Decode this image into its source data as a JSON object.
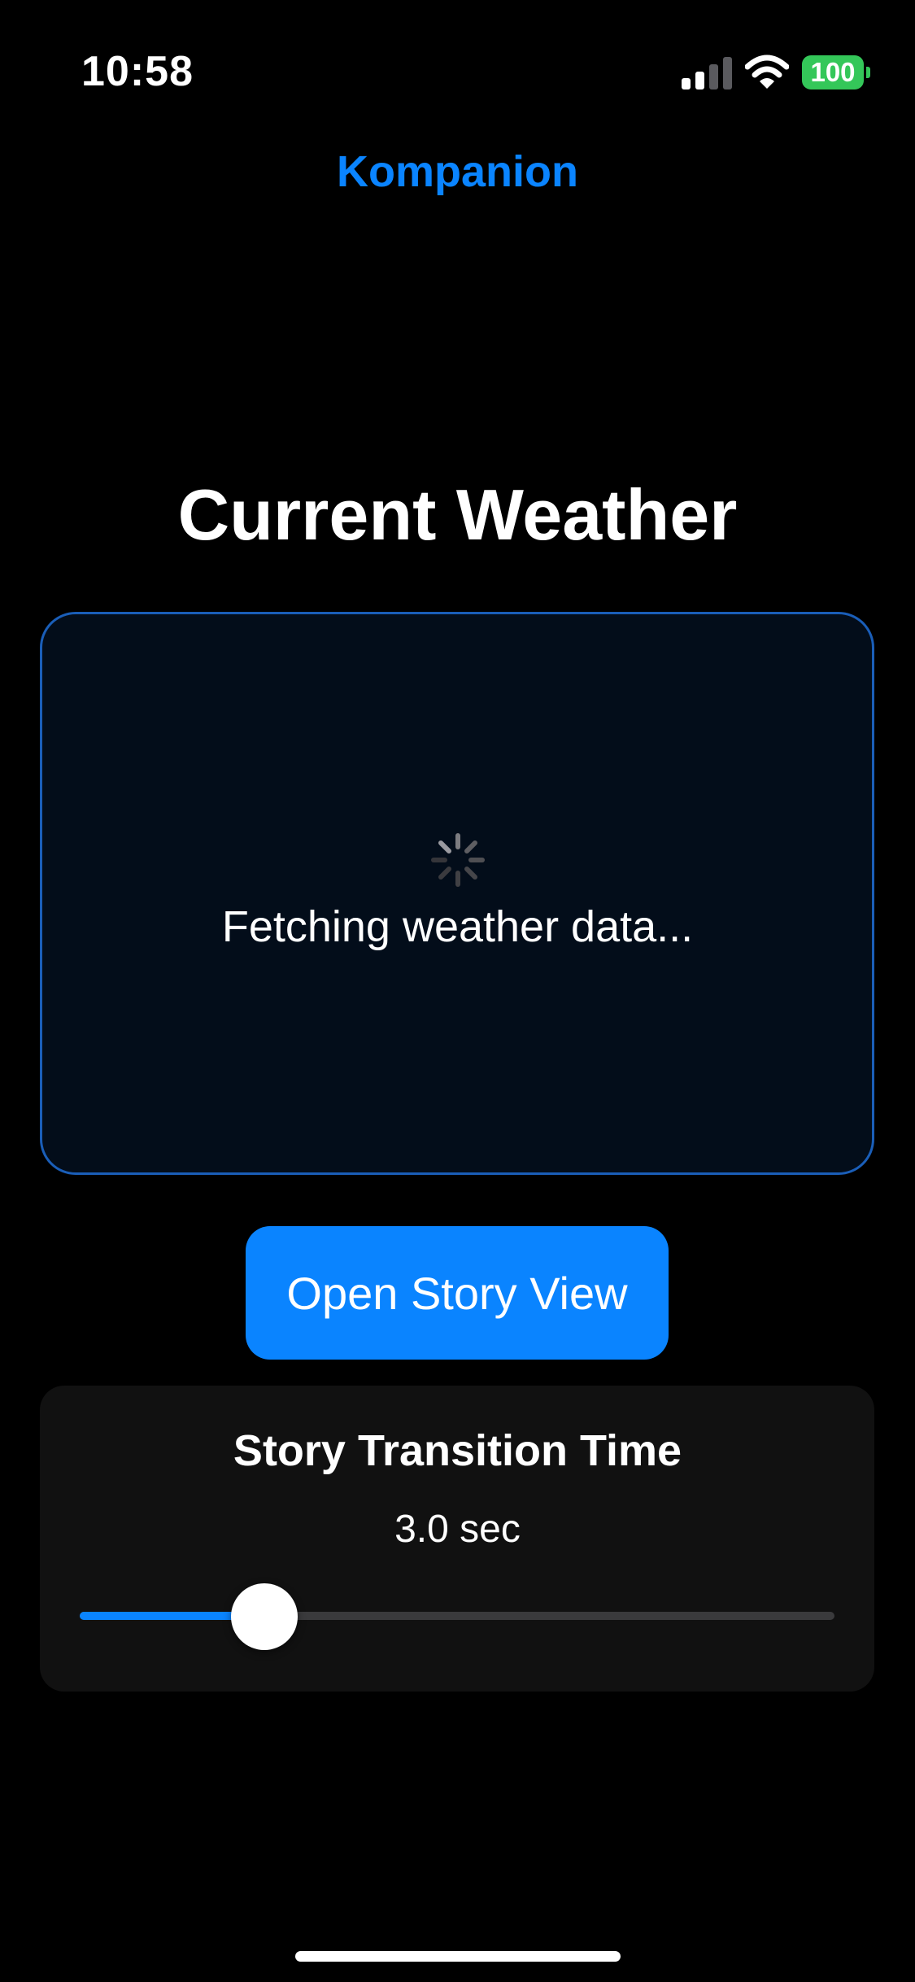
{
  "status_bar": {
    "time": "10:58",
    "battery": "100",
    "icons": [
      "signal-icon",
      "wifi-icon",
      "battery-icon"
    ]
  },
  "nav": {
    "title": "Kompanion"
  },
  "weather": {
    "heading": "Current Weather",
    "loading_text": "Fetching weather data...",
    "loading_icon": "spinner-icon"
  },
  "story_button": {
    "label": "Open Story View"
  },
  "transition_setting": {
    "title": "Story Transition Time",
    "value_text": "3.0 sec",
    "slider_fraction": 0.245
  },
  "colors": {
    "accent": "#0a84ff",
    "card_border": "#1a5eb8",
    "battery_green": "#34c759",
    "background": "#000000",
    "settings_card": "#111111"
  }
}
